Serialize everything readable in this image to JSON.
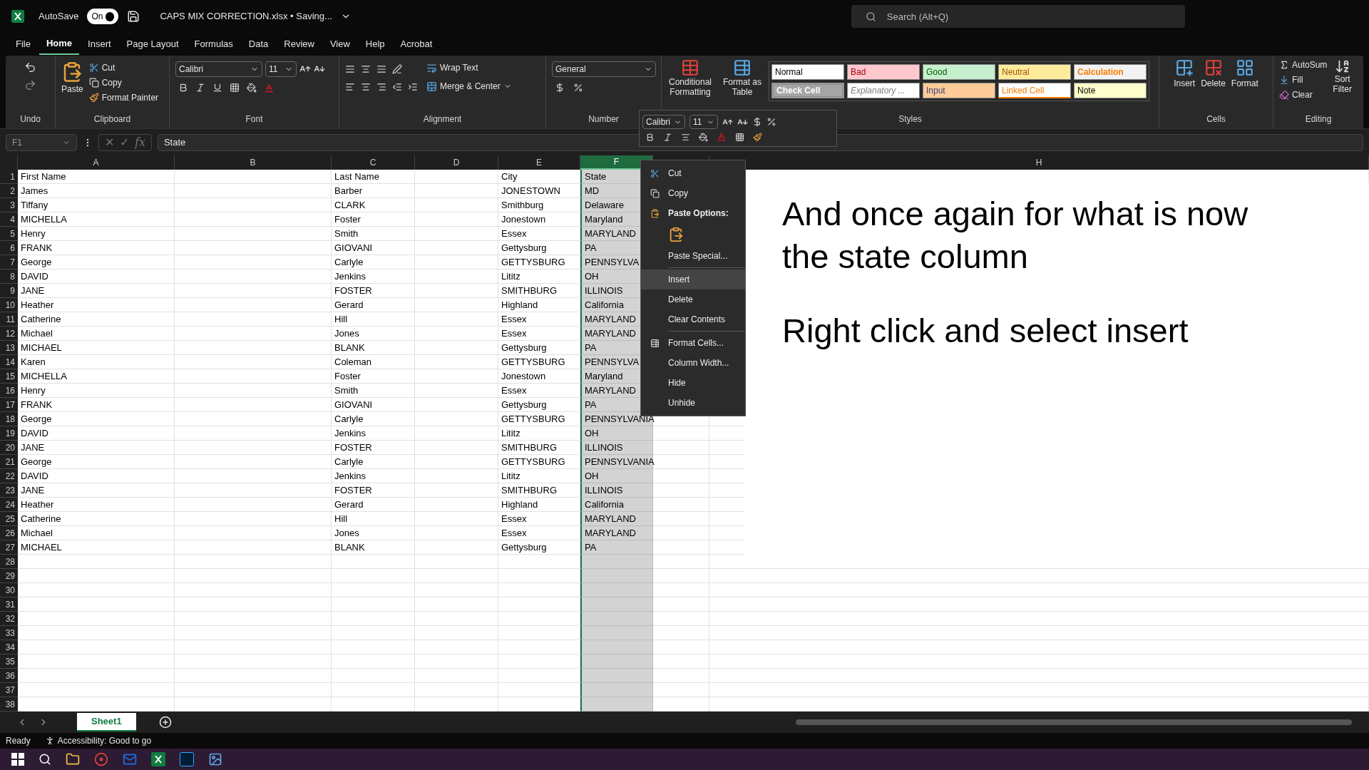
{
  "title_bar": {
    "autosave": {
      "label": "AutoSave",
      "state_text": "On",
      "on": true
    },
    "document_title": "CAPS MIX CORRECTION.xlsx • Saving...",
    "search": {
      "placeholder": "Search (Alt+Q)"
    }
  },
  "menu_tabs": [
    {
      "label": "File",
      "selected": false
    },
    {
      "label": "Home",
      "selected": true
    },
    {
      "label": "Insert",
      "selected": false
    },
    {
      "label": "Page Layout",
      "selected": false
    },
    {
      "label": "Formulas",
      "selected": false
    },
    {
      "label": "Data",
      "selected": false
    },
    {
      "label": "Review",
      "selected": false
    },
    {
      "label": "View",
      "selected": false
    },
    {
      "label": "Help",
      "selected": false
    },
    {
      "label": "Acrobat",
      "selected": false
    }
  ],
  "ribbon": {
    "undo": {
      "label": "Undo"
    },
    "clipboard": {
      "label": "Clipboard",
      "paste": "Paste",
      "cut": "Cut",
      "copy": "Copy",
      "format_painter": "Format Painter"
    },
    "font": {
      "label": "Font",
      "font_name": "Calibri",
      "font_size": "11"
    },
    "alignment": {
      "label": "Alignment",
      "wrap_text": "Wrap Text",
      "merge_center": "Merge & Center"
    },
    "number": {
      "label": "Number",
      "format": "General"
    },
    "styles": {
      "label": "Styles",
      "conditional_formatting": "Conditional Formatting",
      "format_as_table": "Format as Table",
      "cell_styles": [
        {
          "label": "Normal",
          "kind": "normal",
          "color": "#ffffff"
        },
        {
          "label": "Bad",
          "kind": "bad",
          "color": "#ffc7ce"
        },
        {
          "label": "Good",
          "kind": "good",
          "color": "#c6efce"
        },
        {
          "label": "Neutral",
          "kind": "neutral",
          "color": "#ffeb9c"
        },
        {
          "label": "Calculation",
          "kind": "calculation",
          "color": "#f2f2f2"
        },
        {
          "label": "Check Cell",
          "kind": "check",
          "color": "#a5a5a5"
        },
        {
          "label": "Explanatory ...",
          "kind": "explanatory",
          "color": "#ffffff"
        },
        {
          "label": "Input",
          "kind": "input",
          "color": "#ffcc99"
        },
        {
          "label": "Linked Cell",
          "kind": "linked",
          "color": "#ffffff"
        },
        {
          "label": "Note",
          "kind": "note",
          "color": "#ffffcc"
        }
      ]
    },
    "cells": {
      "label": "Cells",
      "insert": "Insert",
      "delete": "Delete",
      "format": "Format"
    },
    "editing": {
      "label": "Editing",
      "autosum": "AutoSum",
      "fill": "Fill",
      "clear": "Clear",
      "sort_lines": [
        "Sort",
        "Filter"
      ]
    }
  },
  "formula_bar": {
    "name_box": "F1",
    "cancel": "✕",
    "enter": "✓",
    "function": "fx",
    "formula": "State"
  },
  "mini_toolbar": {
    "font_name": "Calibri",
    "font_size": "11"
  },
  "sheet": {
    "columns": [
      {
        "label": "A",
        "selected": false
      },
      {
        "label": "B",
        "selected": false
      },
      {
        "label": "C",
        "selected": false
      },
      {
        "label": "D",
        "selected": false
      },
      {
        "label": "E",
        "selected": false
      },
      {
        "label": "F",
        "selected": true
      },
      {
        "selected": false
      },
      {
        "label": "H",
        "selected": false
      }
    ],
    "rows": [
      {
        "number": "1",
        "cells": [
          "First Name",
          "Last Name",
          "City",
          "State"
        ]
      },
      {
        "number": "2",
        "cells": [
          "James",
          "Barber",
          "JONESTOWN",
          "MD"
        ]
      },
      {
        "number": "3",
        "cells": [
          "Tiffany",
          "CLARK",
          "Smithburg",
          "Delaware"
        ]
      },
      {
        "number": "4",
        "cells": [
          "MICHELLA",
          "Foster",
          "Jonestown",
          "Maryland"
        ]
      },
      {
        "number": "5",
        "cells": [
          "Henry",
          "Smith",
          "Essex",
          "MARYLAND"
        ]
      },
      {
        "number": "6",
        "cells": [
          "FRANK",
          "GIOVANI",
          "Gettysburg",
          "PA"
        ]
      },
      {
        "number": "7",
        "cells": [
          "George",
          "Carlyle",
          "GETTYSBURG",
          "PENNSYLVA"
        ]
      },
      {
        "number": "8",
        "cells": [
          "DAVID",
          "Jenkins",
          "Lititz",
          "OH"
        ]
      },
      {
        "number": "9",
        "cells": [
          "JANE",
          "FOSTER",
          "SMITHBURG",
          "ILLINOIS"
        ]
      },
      {
        "number": "10",
        "cells": [
          "Heather",
          "Gerard",
          "Highland",
          "California"
        ]
      },
      {
        "number": "11",
        "cells": [
          "Catherine",
          "Hill",
          "Essex",
          "MARYLAND"
        ]
      },
      {
        "number": "12",
        "cells": [
          "Michael",
          "Jones",
          "Essex",
          "MARYLAND"
        ]
      },
      {
        "number": "13",
        "cells": [
          "MICHAEL",
          "BLANK",
          "Gettysburg",
          "PA"
        ]
      },
      {
        "number": "14",
        "cells": [
          "Karen",
          "Coleman",
          "GETTYSBURG",
          "PENNSYLVA"
        ]
      },
      {
        "number": "15",
        "cells": [
          "MICHELLA",
          "Foster",
          "Jonestown",
          "Maryland"
        ]
      },
      {
        "number": "16",
        "cells": [
          "Henry",
          "Smith",
          "Essex",
          "MARYLAND"
        ]
      },
      {
        "number": "17",
        "cells": [
          "FRANK",
          "GIOVANI",
          "Gettysburg",
          "PA"
        ]
      },
      {
        "number": "18",
        "cells": [
          "George",
          "Carlyle",
          "GETTYSBURG",
          "PENNSYLVANIA"
        ]
      },
      {
        "number": "19",
        "cells": [
          "DAVID",
          "Jenkins",
          "Lititz",
          "OH"
        ]
      },
      {
        "number": "20",
        "cells": [
          "JANE",
          "FOSTER",
          "SMITHBURG",
          "ILLINOIS"
        ]
      },
      {
        "number": "21",
        "cells": [
          "George",
          "Carlyle",
          "GETTYSBURG",
          "PENNSYLVANIA"
        ]
      },
      {
        "number": "22",
        "cells": [
          "DAVID",
          "Jenkins",
          "Lititz",
          "OH"
        ]
      },
      {
        "number": "23",
        "cells": [
          "JANE",
          "FOSTER",
          "SMITHBURG",
          "ILLINOIS"
        ]
      },
      {
        "number": "24",
        "cells": [
          "Heather",
          "Gerard",
          "Highland",
          "California"
        ]
      },
      {
        "number": "25",
        "cells": [
          "Catherine",
          "Hill",
          "Essex",
          "MARYLAND"
        ]
      },
      {
        "number": "26",
        "cells": [
          "Michael",
          "Jones",
          "Essex",
          "MARYLAND"
        ]
      },
      {
        "number": "27",
        "cells": [
          "MICHAEL",
          "BLANK",
          "Gettysburg",
          "PA"
        ]
      },
      {
        "number": "28"
      },
      {
        "number": "29"
      },
      {
        "number": "30"
      },
      {
        "number": "31"
      },
      {
        "number": "32"
      },
      {
        "number": "33"
      },
      {
        "number": "34"
      },
      {
        "number": "35"
      },
      {
        "number": "36"
      },
      {
        "number": "37"
      },
      {
        "number": "38"
      }
    ]
  },
  "text_box": {
    "paragraphs": [
      "And once again for what is now the state column",
      "Right click and select insert"
    ]
  },
  "context_menu": {
    "items": [
      {
        "kind": "item",
        "label": "Cut",
        "selected": false
      },
      {
        "kind": "item",
        "label": "Copy",
        "selected": false
      },
      {
        "kind": "header",
        "label": "Paste Options:"
      },
      {
        "kind": "paste-icon"
      },
      {
        "kind": "item",
        "label": "Paste Special...",
        "selected": false
      },
      {
        "kind": "separator"
      },
      {
        "kind": "item",
        "label": "Insert",
        "selected": true
      },
      {
        "kind": "item",
        "label": "Delete",
        "selected": false
      },
      {
        "kind": "item",
        "label": "Clear Contents",
        "selected": false
      },
      {
        "kind": "separator"
      },
      {
        "kind": "item",
        "label": "Format Cells...",
        "selected": false
      },
      {
        "kind": "item",
        "label": "Column Width...",
        "selected": false
      },
      {
        "kind": "item",
        "label": "Hide",
        "selected": false
      },
      {
        "kind": "item",
        "label": "Unhide",
        "selected": false
      }
    ]
  },
  "sheet_tabs": [
    {
      "label": "Sheet1",
      "selected": true
    }
  ],
  "status_bar": {
    "ready": "Ready",
    "accessibility": "Accessibility: Good to go"
  }
}
